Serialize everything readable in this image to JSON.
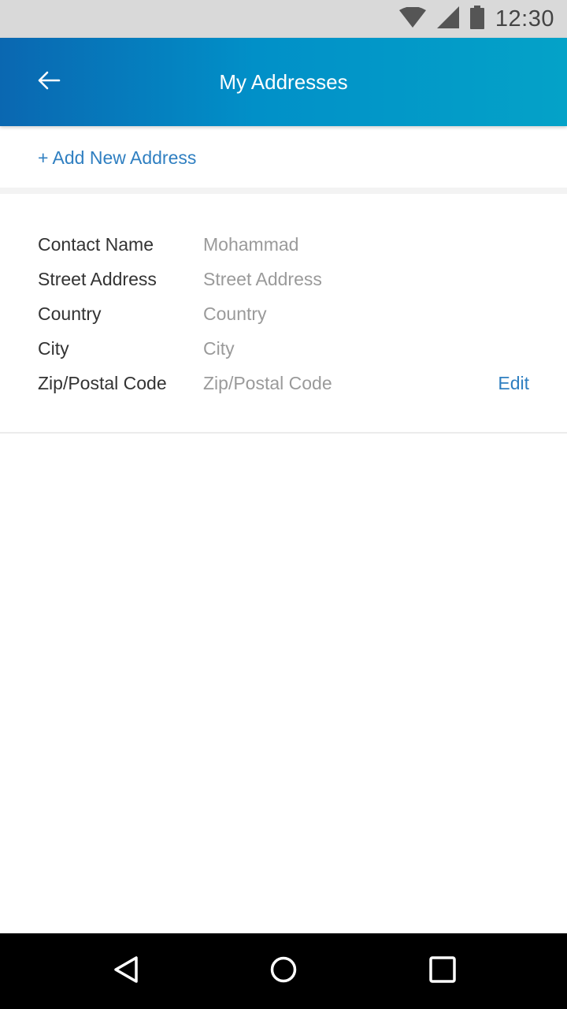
{
  "status_bar": {
    "time": "12:30",
    "icons": [
      "wifi-icon",
      "cell-signal-icon",
      "battery-icon"
    ]
  },
  "app_bar": {
    "title": "My Addresses",
    "back_icon": "back-arrow-icon",
    "gradient_start": "#0a67b1",
    "gradient_end": "#04a2c8"
  },
  "add_address": {
    "label": "+ Add New Address",
    "color": "#2f7fc1"
  },
  "address": {
    "fields": [
      {
        "label": "Contact Name",
        "value": "Mohammad"
      },
      {
        "label": "Street Address",
        "value": "Street Address"
      },
      {
        "label": "Country",
        "value": "Country"
      },
      {
        "label": "City",
        "value": "City"
      },
      {
        "label": "Zip/Postal Code",
        "value": "Zip/Postal Code"
      }
    ],
    "edit_label": "Edit"
  },
  "nav_bar": {
    "icons": [
      "back-triangle-icon",
      "home-circle-icon",
      "recents-square-icon"
    ]
  }
}
